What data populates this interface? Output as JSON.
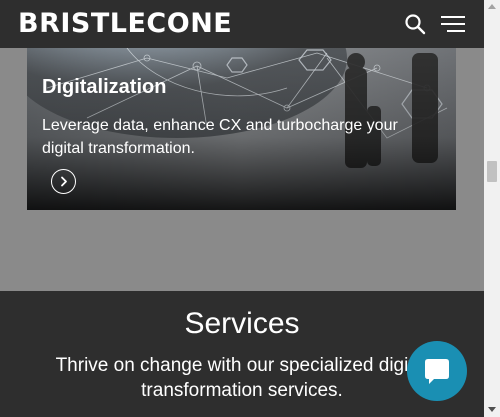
{
  "header": {
    "logo_text": "BRISTLECONE",
    "search_icon": "search-icon",
    "menu_icon": "hamburger-menu-icon"
  },
  "hero": {
    "title": "Digitalization",
    "description": "Leverage data, enhance CX and turbocharge your digital transformation.",
    "arrow_icon": "chevron-right-icon"
  },
  "services": {
    "title": "Services",
    "subtitle": "Thrive on change with our specialized digital transformation services."
  },
  "chat": {
    "icon": "chat-bubble-icon",
    "color": "#1a8fb3"
  },
  "colors": {
    "header_bg": "#2e2e2e",
    "page_bg": "#8a8a8a",
    "accent": "#1a8fb3"
  }
}
